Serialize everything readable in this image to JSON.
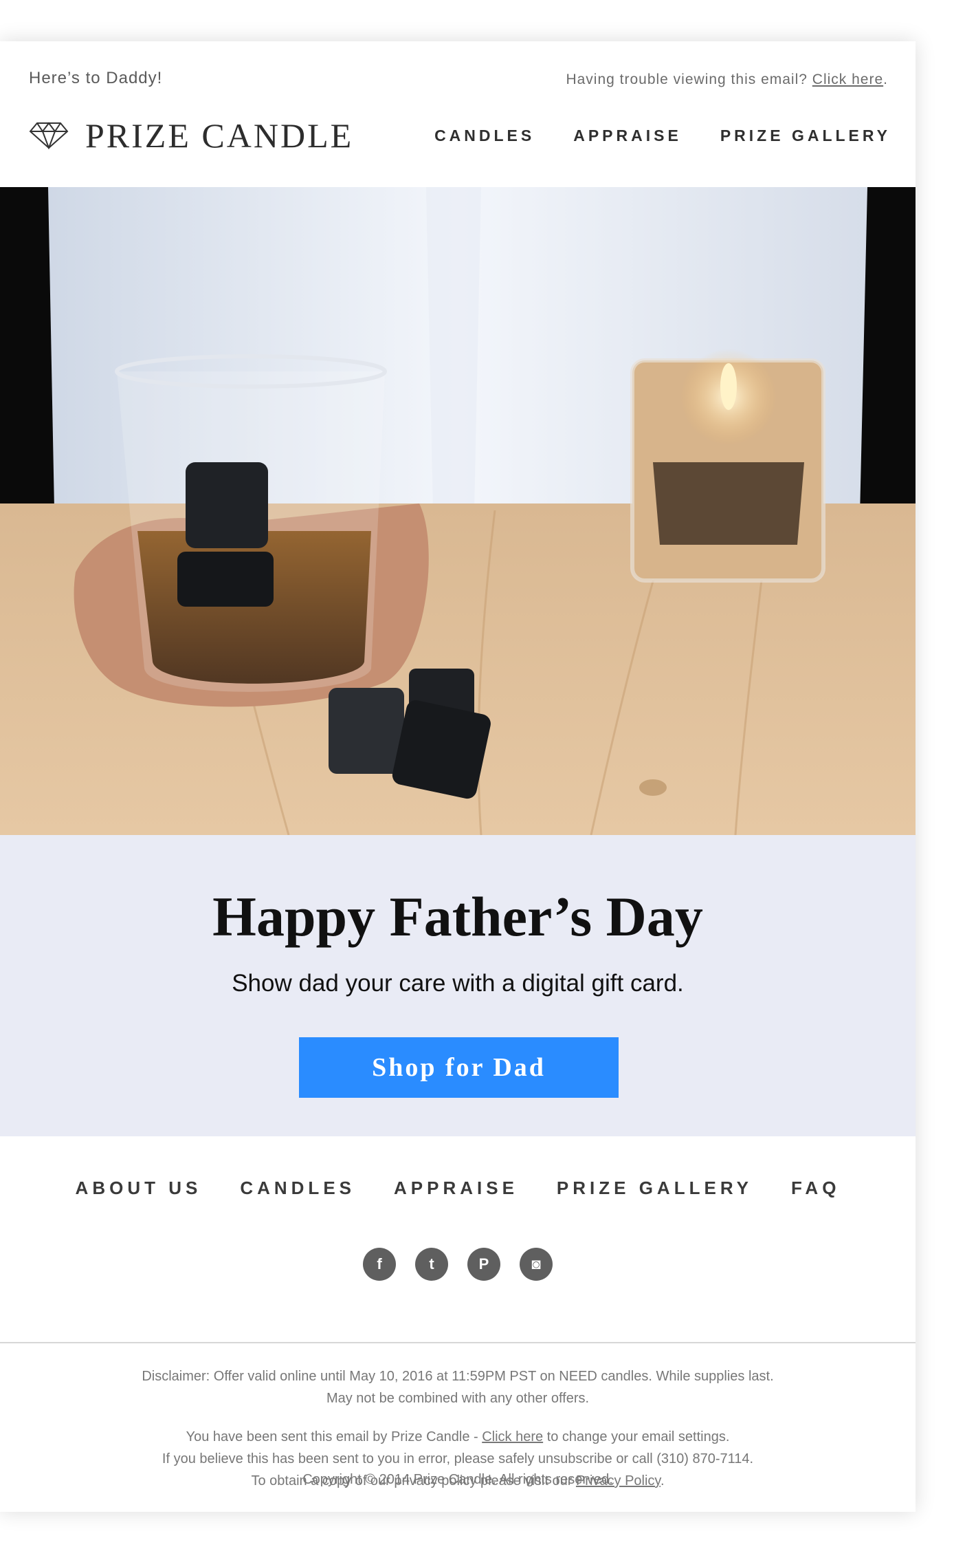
{
  "header": {
    "preheader": "Here’s to Daddy!",
    "trouble_text": "Having trouble viewing this email?",
    "trouble_link": "Click here",
    "trouble_end": ".",
    "brand": "PRIZE CANDLE",
    "logo_icon": "diamond-icon",
    "nav": [
      "CANDLES",
      "APPRAISE",
      "PRIZE GALLERY"
    ]
  },
  "hero": {
    "image": "hand-holding-whiskey-glass-with-stones-and-candle"
  },
  "promo": {
    "title": "Happy Father’s Day",
    "subtitle": "Show dad your care with a digital gift card.",
    "cta_label": "Shop for Dad",
    "cta_color": "#2a8cff",
    "background": "#e9ebf5"
  },
  "footer": {
    "nav": [
      "ABOUT US",
      "CANDLES",
      "APPRAISE",
      "PRIZE GALLERY",
      "FAQ"
    ],
    "social": [
      {
        "icon": "facebook-icon",
        "glyph": "f"
      },
      {
        "icon": "twitter-icon",
        "glyph": "t"
      },
      {
        "icon": "pinterest-icon",
        "glyph": "P"
      },
      {
        "icon": "instagram-icon",
        "glyph": "◙"
      }
    ],
    "disclaimer_1": "Disclaimer: Offer valid online until May 10, 2016 at 11:59PM PST on NEED candles. While supplies last.",
    "disclaimer_2": "May not be combined with any other offers.",
    "sent_pre": "You have been sent this email by Prize Candle - ",
    "sent_link": "Click here",
    "sent_post": " to change your email settings.",
    "error_line": "If you believe this has been sent to you in error, please safely unsubscribe or call (310) 870-7114.",
    "privacy_pre": "To obtain a copy of our privacy policy please visit our ",
    "privacy_link": "Privacy Policy",
    "privacy_post": ".",
    "copyright": "Copyright © 2014 Prize Candle. All rights reserved."
  }
}
